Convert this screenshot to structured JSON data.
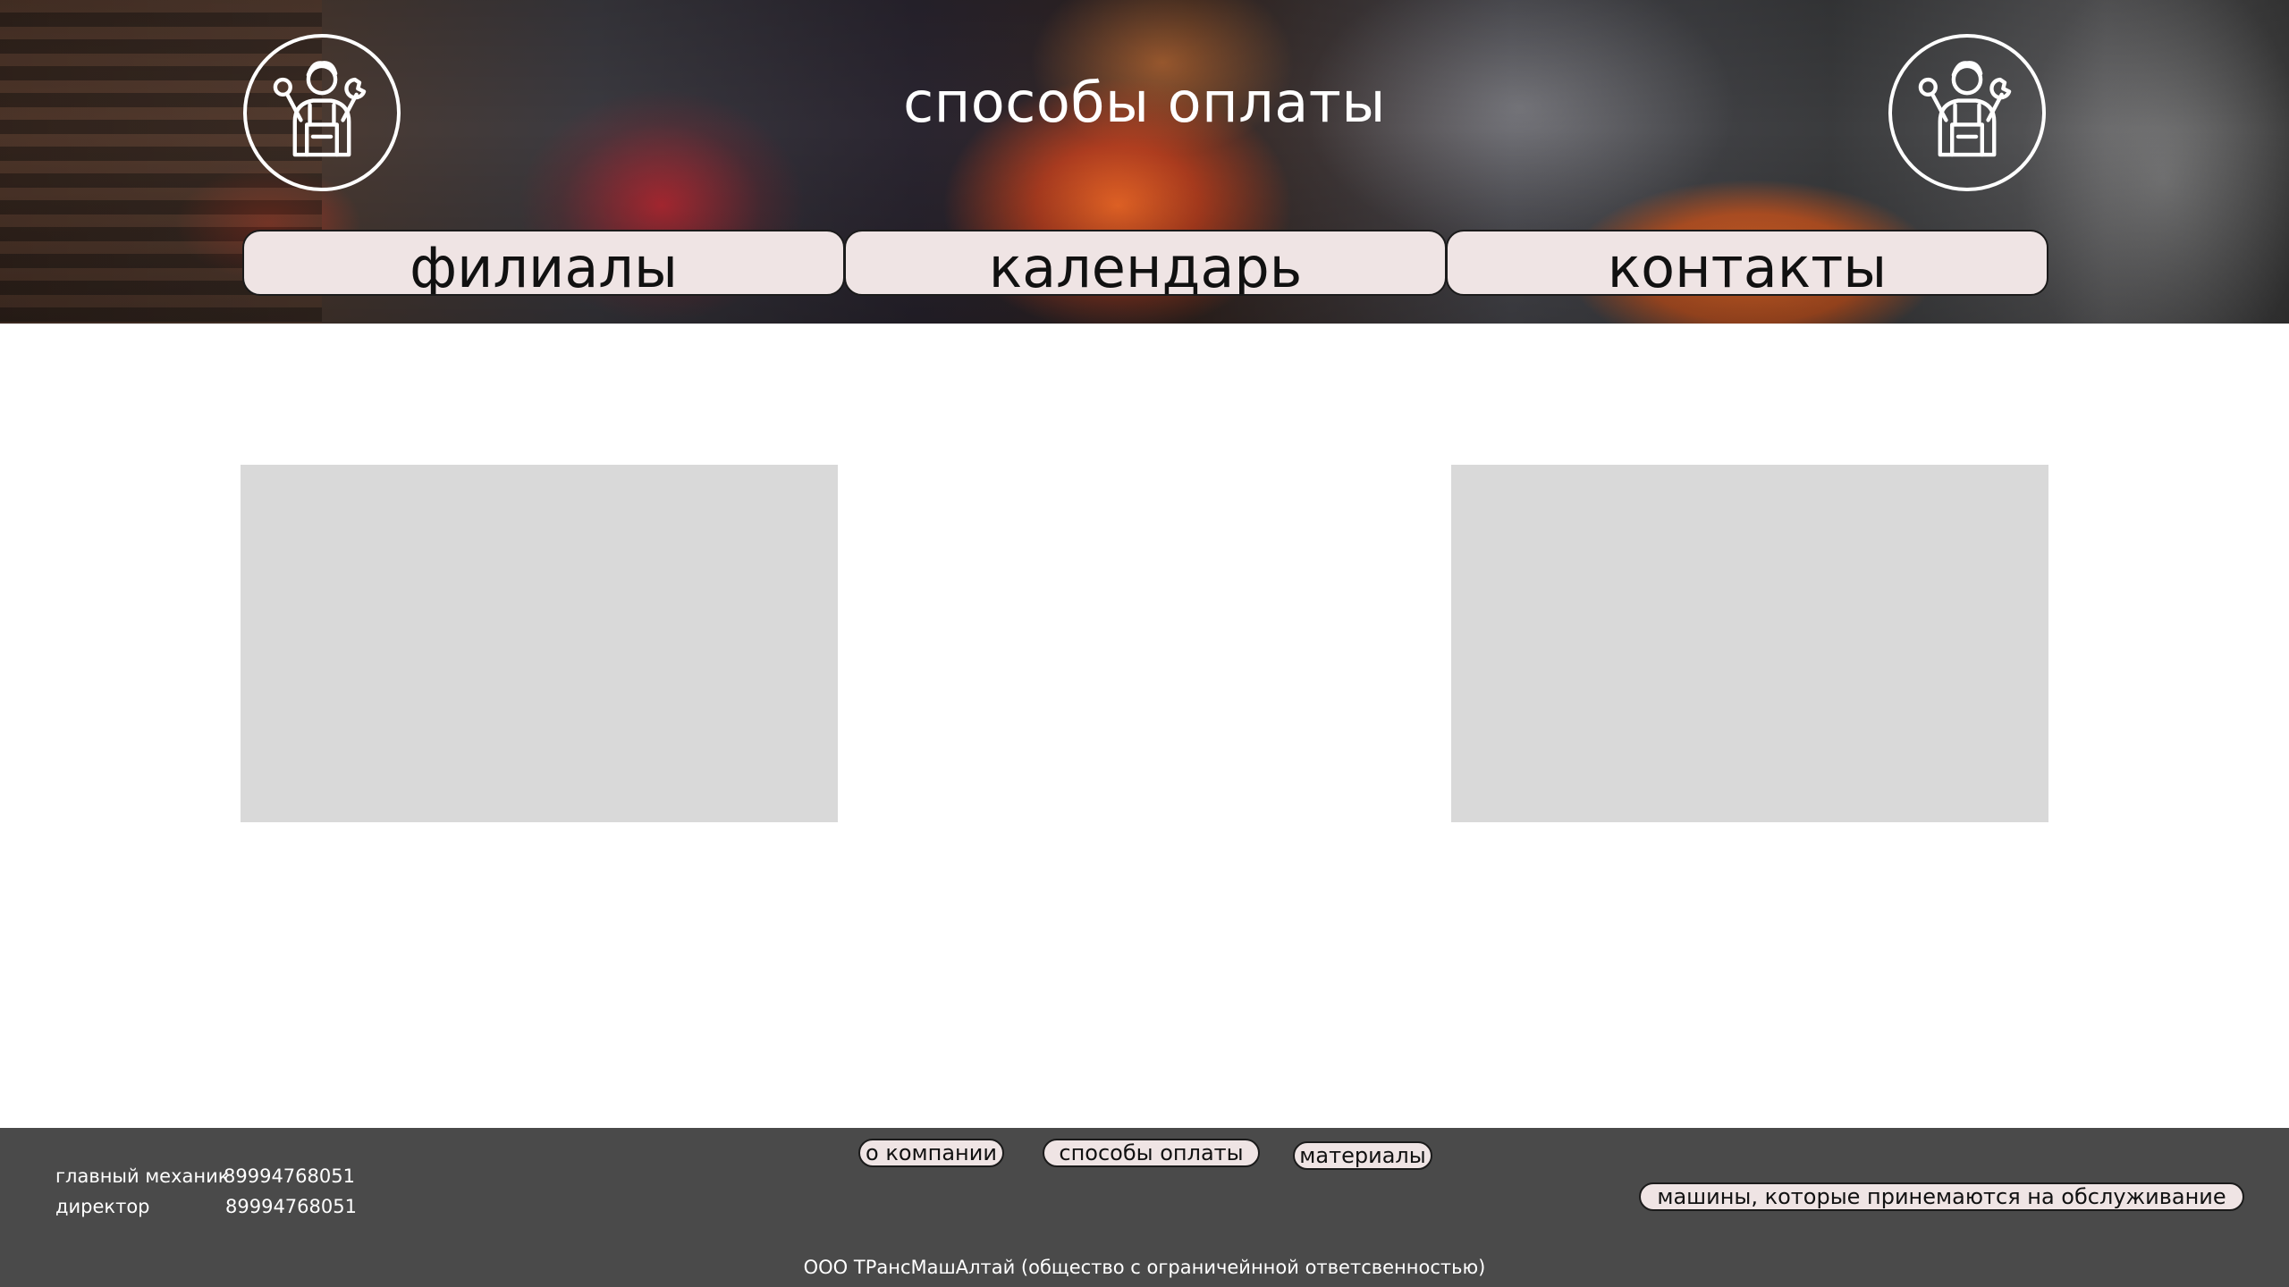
{
  "header": {
    "title": "способы оплаты",
    "logo_left_icon": "mechanic-icon",
    "logo_right_icon": "mechanic-icon",
    "nav": [
      {
        "label": "филиалы"
      },
      {
        "label": "календарь"
      },
      {
        "label": "контакты"
      }
    ]
  },
  "main": {
    "placeholders": [
      "image-placeholder",
      "image-placeholder"
    ]
  },
  "footer": {
    "contacts": [
      {
        "role": "главный механик",
        "phone": "89994768051"
      },
      {
        "role": "директор",
        "phone": "89994768051"
      }
    ],
    "links": [
      {
        "label": "о компании"
      },
      {
        "label": "способы оплаты"
      },
      {
        "label": "материалы"
      },
      {
        "label": "машины, которые принемаются на обслуживание"
      }
    ],
    "company": "ООО ТРансМашАлтай (общество с ограничейнной ответсвенностью)"
  },
  "colors": {
    "button_bg": "#efe4e4",
    "placeholder": "#d9d9d9",
    "footer_bg": "#4a4a4a",
    "text_light": "#ffffff"
  }
}
